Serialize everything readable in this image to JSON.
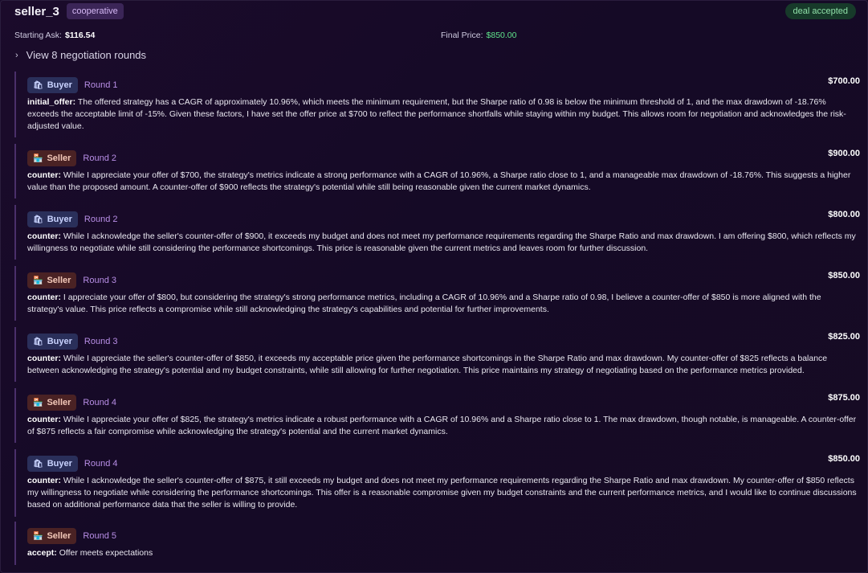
{
  "header": {
    "seller_name": "seller_3",
    "strategy_badge": "cooperative",
    "status": "deal accepted"
  },
  "prices": {
    "starting_ask_label": "Starting Ask:",
    "starting_ask_value": "$116.54",
    "final_price_label": "Final Price:",
    "final_price_value": "$850.00"
  },
  "rounds_toggle": "View 8 negotiation rounds",
  "messages": [
    {
      "role": "Buyer",
      "round": "Round 1",
      "amount": "$700.00",
      "kind": "initial_offer:",
      "text": "The offered strategy has a CAGR of approximately 10.96%, which meets the minimum requirement, but the Sharpe ratio of 0.98 is below the minimum threshold of 1, and the max drawdown of -18.76% exceeds the acceptable limit of -15%. Given these factors, I have set the offer price at $700 to reflect the performance shortfalls while staying within my budget. This allows room for negotiation and acknowledges the risk-adjusted value."
    },
    {
      "role": "Seller",
      "round": "Round 2",
      "amount": "$900.00",
      "kind": "counter:",
      "text": "While I appreciate your offer of $700, the strategy's metrics indicate a strong performance with a CAGR of 10.96%, a Sharpe ratio close to 1, and a manageable max drawdown of -18.76%. This suggests a higher value than the proposed amount. A counter-offer of $900 reflects the strategy's potential while still being reasonable given the current market dynamics."
    },
    {
      "role": "Buyer",
      "round": "Round 2",
      "amount": "$800.00",
      "kind": "counter:",
      "text": "While I acknowledge the seller's counter-offer of $900, it exceeds my budget and does not meet my performance requirements regarding the Sharpe Ratio and max drawdown. I am offering $800, which reflects my willingness to negotiate while still considering the performance shortcomings. This price is reasonable given the current metrics and leaves room for further discussion."
    },
    {
      "role": "Seller",
      "round": "Round 3",
      "amount": "$850.00",
      "kind": "counter:",
      "text": "I appreciate your offer of $800, but considering the strategy's strong performance metrics, including a CAGR of 10.96% and a Sharpe ratio of 0.98, I believe a counter-offer of $850 is more aligned with the strategy's value. This price reflects a compromise while still acknowledging the strategy's capabilities and potential for further improvements."
    },
    {
      "role": "Buyer",
      "round": "Round 3",
      "amount": "$825.00",
      "kind": "counter:",
      "text": "While I appreciate the seller's counter-offer of $850, it exceeds my acceptable price given the performance shortcomings in the Sharpe Ratio and max drawdown. My counter-offer of $825 reflects a balance between acknowledging the strategy's potential and my budget constraints, while still allowing for further negotiation. This price maintains my strategy of negotiating based on the performance metrics provided."
    },
    {
      "role": "Seller",
      "round": "Round 4",
      "amount": "$875.00",
      "kind": "counter:",
      "text": "While I appreciate your offer of $825, the strategy's metrics indicate a robust performance with a CAGR of 10.96% and a Sharpe ratio close to 1. The max drawdown, though notable, is manageable. A counter-offer of $875 reflects a fair compromise while acknowledging the strategy's potential and the current market dynamics."
    },
    {
      "role": "Buyer",
      "round": "Round 4",
      "amount": "$850.00",
      "kind": "counter:",
      "text": "While I acknowledge the seller's counter-offer of $875, it still exceeds my budget and does not meet my performance requirements regarding the Sharpe Ratio and max drawdown. My counter-offer of $850 reflects my willingness to negotiate while considering the performance shortcomings. This offer is a reasonable compromise given my budget constraints and the current performance metrics, and I would like to continue discussions based on additional performance data that the seller is willing to provide."
    },
    {
      "role": "Seller",
      "round": "Round 5",
      "amount": "",
      "kind": "accept:",
      "text": "Offer meets expectations"
    }
  ],
  "icons": {
    "buyer": "buyer-icon",
    "seller": "seller-icon",
    "chevron": "chevron-right-icon"
  },
  "colors": {
    "accent_purple": "#b88ee6",
    "status_green": "#5fe38b",
    "buyer_badge": "#2a2f5a",
    "seller_badge": "#4a2224"
  }
}
